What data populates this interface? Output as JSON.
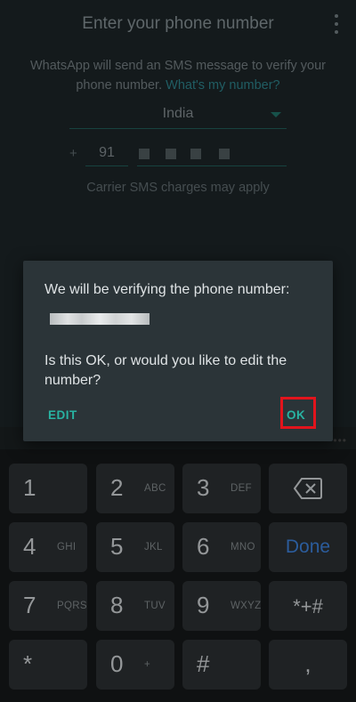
{
  "screen": {
    "title": "Enter your phone number",
    "description_main": "WhatsApp will send an SMS message to verify your phone number.",
    "description_link": "What's my number?",
    "country": "India",
    "plus_sign": "+",
    "country_code": "91",
    "carrier_note": "Carrier SMS charges may apply"
  },
  "dialog": {
    "message_line1": "We will be verifying the phone number:",
    "message_line2": "Is this OK, or would you like to edit the number?",
    "edit_label": "EDIT",
    "ok_label": "OK"
  },
  "keyboard": {
    "keys": [
      {
        "main": "1",
        "sub": ""
      },
      {
        "main": "2",
        "sub": "ABC"
      },
      {
        "main": "3",
        "sub": "DEF"
      },
      {
        "main": "4",
        "sub": "GHI"
      },
      {
        "main": "5",
        "sub": "JKL"
      },
      {
        "main": "6",
        "sub": "MNO"
      },
      {
        "main": "7",
        "sub": "PQRS"
      },
      {
        "main": "8",
        "sub": "TUV"
      },
      {
        "main": "9",
        "sub": "WXYZ"
      },
      {
        "main": "*",
        "sub": ""
      },
      {
        "main": "0",
        "sub": "+"
      },
      {
        "main": "#",
        "sub": ""
      }
    ],
    "done_label": "Done",
    "symbols_label": "*+#",
    "comma_label": ","
  },
  "colors": {
    "accent": "#28b3a2",
    "highlight": "#e2141c",
    "done": "#3a7bd0"
  }
}
